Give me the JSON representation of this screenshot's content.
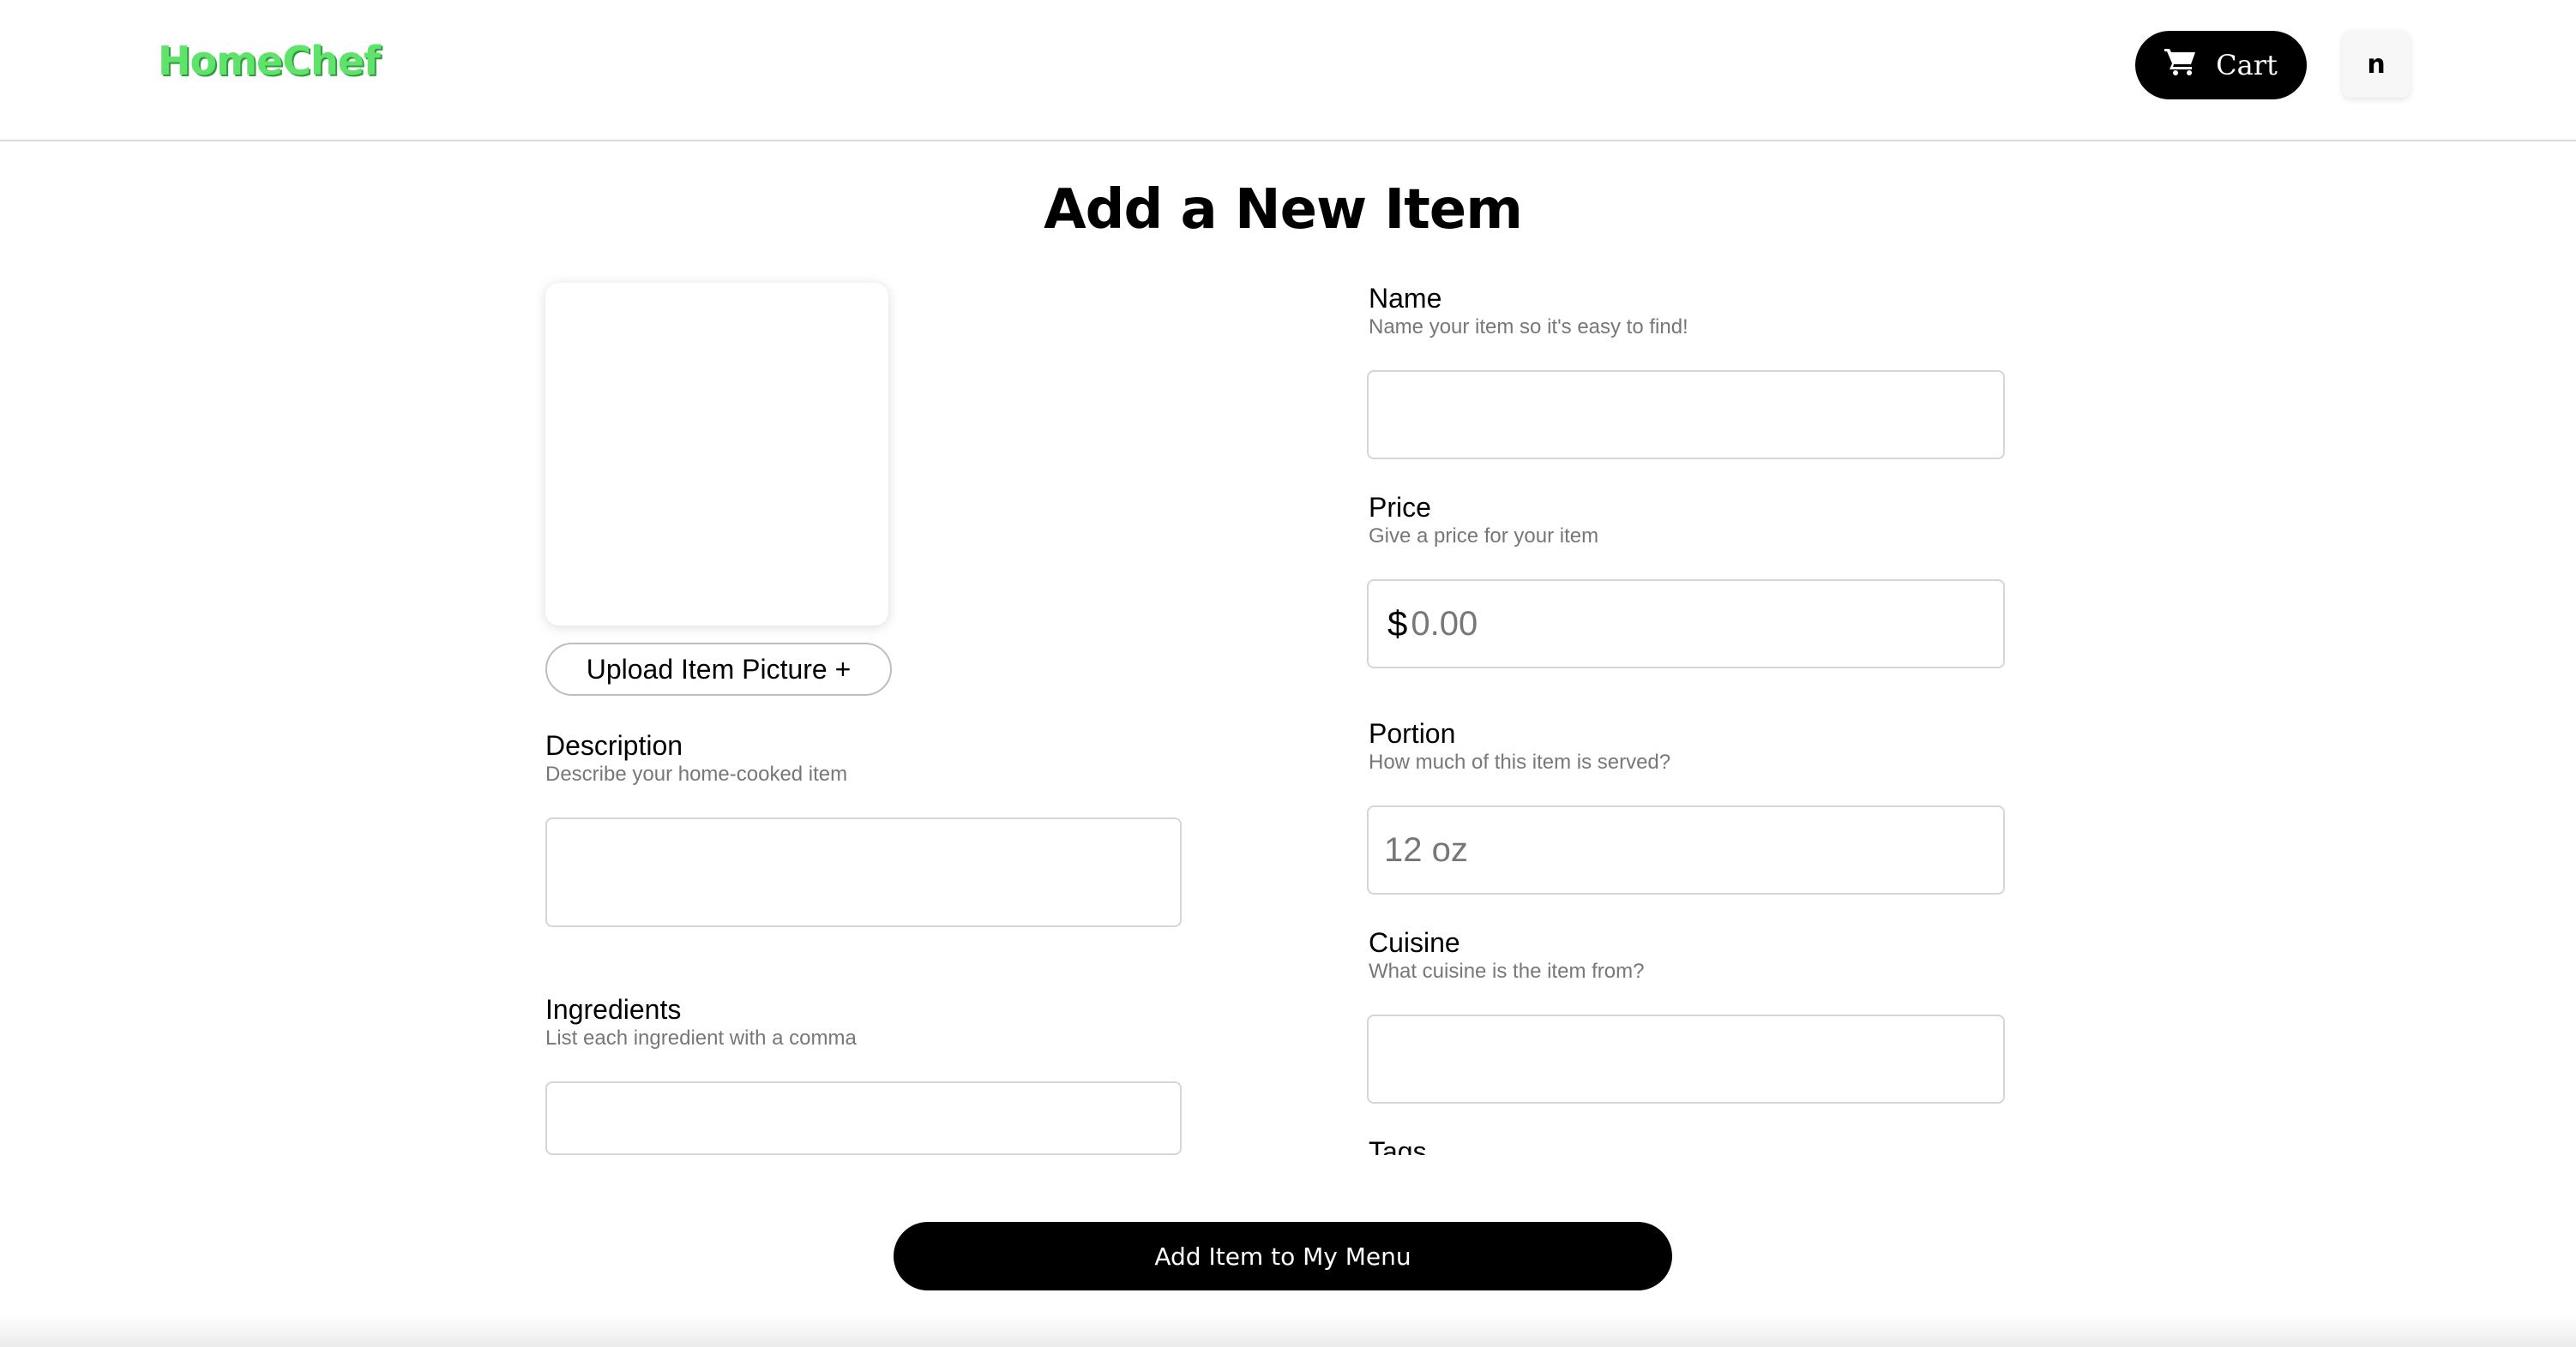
{
  "header": {
    "logo": "HomeChef",
    "cart_label": "Cart",
    "cart_icon": "shopping-cart-icon",
    "avatar_letter": "n"
  },
  "page": {
    "title": "Add a New Item"
  },
  "photo": {
    "upload_label": "Upload Item Picture +"
  },
  "fields": {
    "name": {
      "label": "Name",
      "hint": "Name your item so it's easy to find!",
      "value": "",
      "placeholder": ""
    },
    "price": {
      "label": "Price",
      "hint": "Give a price for your item",
      "currency": "$",
      "value": "",
      "placeholder": "0.00"
    },
    "portion": {
      "label": "Portion",
      "hint": "How much of this item is served?",
      "value": "",
      "placeholder": "12 oz"
    },
    "cuisine": {
      "label": "Cuisine",
      "hint": "What cuisine is the item from?",
      "value": "",
      "placeholder": ""
    },
    "description": {
      "label": "Description",
      "hint": "Describe your home-cooked item",
      "value": "",
      "placeholder": ""
    },
    "ingredients": {
      "label": "Ingredients",
      "hint": "List each ingredient with a comma",
      "value": "",
      "placeholder": ""
    },
    "tags": {
      "label": "Tags"
    }
  },
  "submit": {
    "label": "Add Item to My Menu"
  },
  "colors": {
    "brand": "#5fe36b",
    "button": "#000000"
  }
}
